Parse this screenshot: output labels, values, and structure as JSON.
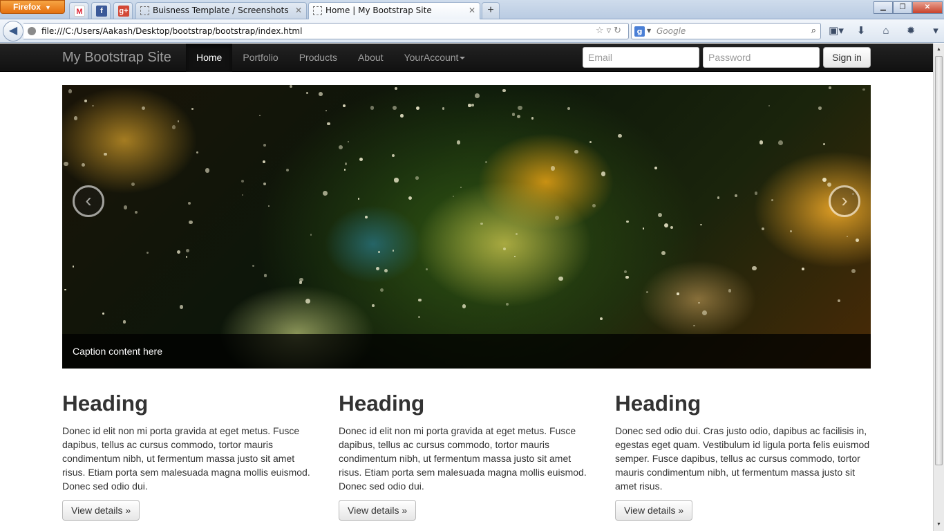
{
  "browser": {
    "menu_label": "Firefox",
    "tabs": [
      {
        "title": "Buisness Template / Screenshots"
      },
      {
        "title": "Home | My Bootstrap Site"
      }
    ],
    "url": "file:///C:/Users/Aakash/Desktop/bootstrap/bootstrap/index.html",
    "search_placeholder": "Google",
    "search_engine_glyph": "g"
  },
  "site": {
    "brand": "My Bootstrap Site",
    "nav": [
      {
        "label": "Home",
        "active": true
      },
      {
        "label": "Portfolio"
      },
      {
        "label": "Products"
      },
      {
        "label": "About"
      },
      {
        "label": "YourAccount"
      }
    ],
    "signin": {
      "email_placeholder": "Email",
      "password_placeholder": "Password",
      "button_label": "Sign in"
    },
    "carousel": {
      "caption": "Caption content here",
      "prev_glyph": "‹",
      "next_glyph": "›"
    },
    "columns": [
      {
        "heading": "Heading",
        "text": "Donec id elit non mi porta gravida at eget metus. Fusce dapibus, tellus ac cursus commodo, tortor mauris condimentum nibh, ut fermentum massa justo sit amet risus. Etiam porta sem malesuada magna mollis euismod. Donec sed odio dui.",
        "button": "View details »"
      },
      {
        "heading": "Heading",
        "text": "Donec id elit non mi porta gravida at eget metus. Fusce dapibus, tellus ac cursus commodo, tortor mauris condimentum nibh, ut fermentum massa justo sit amet risus. Etiam porta sem malesuada magna mollis euismod. Donec sed odio dui.",
        "button": "View details »"
      },
      {
        "heading": "Heading",
        "text": "Donec sed odio dui. Cras justo odio, dapibus ac facilisis in, egestas eget quam. Vestibulum id ligula porta felis euismod semper. Fusce dapibus, tellus ac cursus commodo, tortor mauris condimentum nibh, ut fermentum massa justo sit amet risus.",
        "button": "View details »"
      }
    ]
  },
  "colors": {
    "navbar_bg": "#111111",
    "navbar_text": "#9d9d9d",
    "firefox_orange": "#e4700f"
  }
}
